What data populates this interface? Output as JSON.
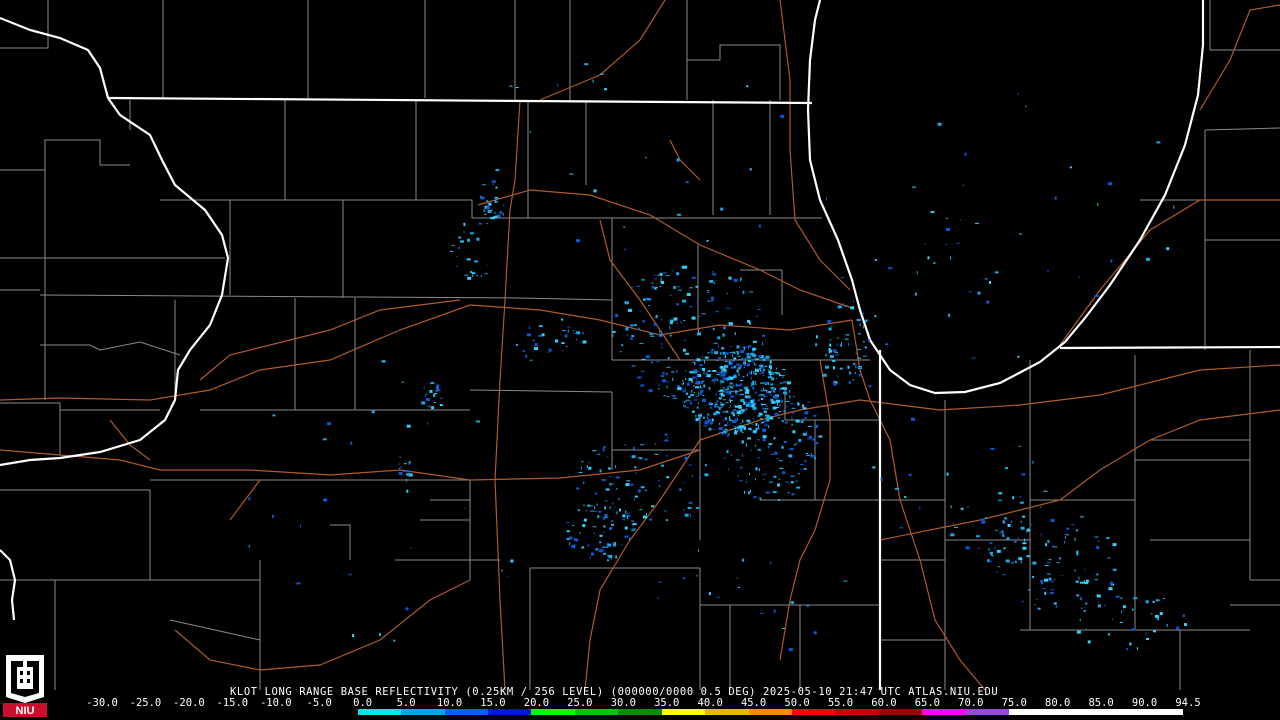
{
  "product": {
    "title": "KLOT LONG RANGE BASE REFLECTIVITY (0.25KM / 256 LEVEL) (000000/0000 0.5 DEG) 2025-05-10 21:47 UTC  ATLAS.NIU.EDU",
    "logo_text": "NIU"
  },
  "legend": {
    "ticks": [
      "-30.0",
      "-25.0",
      "-20.0",
      "-15.0",
      "-10.0",
      "-5.0",
      "0.0",
      "5.0",
      "10.0",
      "15.0",
      "20.0",
      "25.0",
      "30.0",
      "35.0",
      "40.0",
      "45.0",
      "50.0",
      "55.0",
      "60.0",
      "65.0",
      "70.0",
      "75.0",
      "80.0",
      "85.0",
      "90.0",
      "94.5"
    ],
    "colors": [
      "#000000",
      "#000000",
      "#000000",
      "#000000",
      "#000000",
      "#000000",
      "#00e6e6",
      "#00a8f0",
      "#0060f0",
      "#0018d8",
      "#00ff00",
      "#00c800",
      "#008c00",
      "#ffff00",
      "#e6b800",
      "#ff8c00",
      "#ff0000",
      "#c80000",
      "#a00000",
      "#ff00ff",
      "#9a4ad8",
      "#ffffff",
      "#ffffff",
      "#ffffff",
      "#ffffff"
    ]
  },
  "map_style": {
    "state_line": "#ffffff",
    "county_line": "#8a8a8a",
    "highway": "#b05a2a",
    "echo_main": "#1aa8e8",
    "echo_bright": "#30d0ff",
    "echo_dark": "#0a5ad8"
  }
}
